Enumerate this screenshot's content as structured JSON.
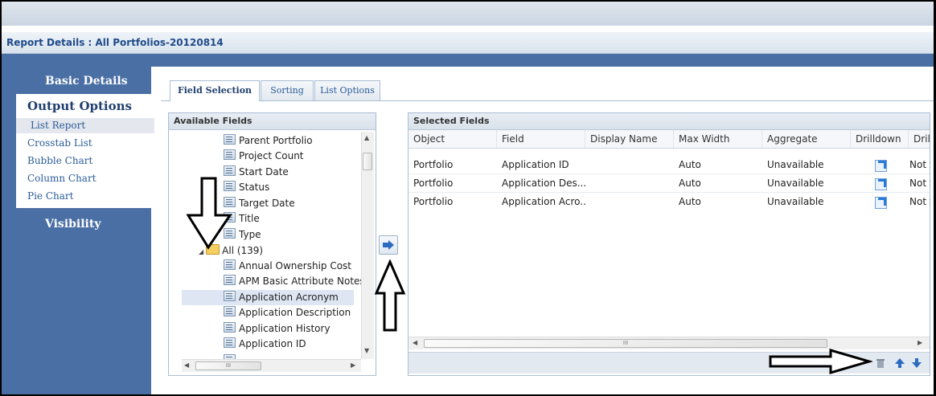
{
  "title": "Report Details : All Portfolios-20120814",
  "sidebar": {
    "basic_details": "Basic Details",
    "output_options": "Output Options",
    "items": [
      {
        "label": "List Report",
        "selected": true
      },
      {
        "label": "Crosstab List"
      },
      {
        "label": "Bubble Chart"
      },
      {
        "label": "Column Chart"
      },
      {
        "label": "Pie Chart"
      }
    ],
    "visibility": "Visibility"
  },
  "tabs": [
    {
      "label": "Field Selection",
      "active": true
    },
    {
      "label": "Sorting"
    },
    {
      "label": "List Options"
    }
  ],
  "available_fields": {
    "header": "Available Fields",
    "items_before": [
      "Parent Portfolio",
      "Project Count",
      "Start Date",
      "Status",
      "Target Date",
      "Title",
      "Type"
    ],
    "folder": "All (139)",
    "items_after": [
      "Annual Ownership Cost",
      "APM Basic Attribute Notes",
      "Application Acronym",
      "Application Description",
      "Application History",
      "Application ID"
    ],
    "selected": "Application Acronym"
  },
  "selected_fields": {
    "header": "Selected Fields",
    "columns": [
      "Object",
      "Field",
      "Display Name",
      "Max Width",
      "Aggregate",
      "Drilldown",
      "Drillc"
    ],
    "rows": [
      {
        "object": "Portfolio",
        "field": "Application ID",
        "display_name": "",
        "max_width": "Auto",
        "aggregate": "Unavailable",
        "drill2": "Not S"
      },
      {
        "object": "Portfolio",
        "field": "Application Des...",
        "display_name": "",
        "max_width": "Auto",
        "aggregate": "Unavailable",
        "drill2": "Not S"
      },
      {
        "object": "Portfolio",
        "field": "Application Acro...",
        "display_name": "",
        "max_width": "Auto",
        "aggregate": "Unavailable",
        "drill2": "Not S"
      }
    ]
  },
  "scroll_grip": "III",
  "icons": {
    "move_right": "arrow-right-icon",
    "delete": "trash-icon",
    "up": "arrow-up-icon",
    "down": "arrow-down-icon",
    "drilldown": "external-link-icon"
  }
}
